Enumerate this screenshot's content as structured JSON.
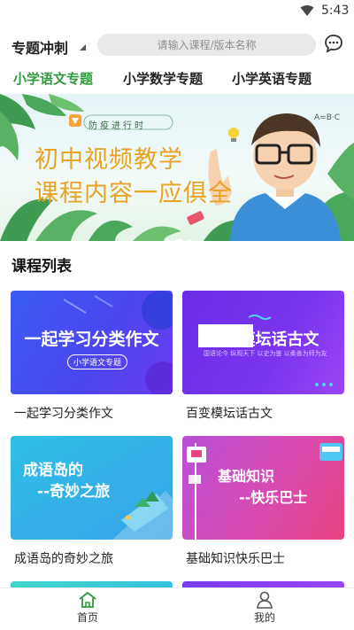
{
  "status_bar": {
    "time": "5:43",
    "wifi_icon": "wifi-icon"
  },
  "header": {
    "title": "专题冲刺",
    "search_placeholder": "请输入课程/版本名称",
    "message_icon": "chat-bubble-icon"
  },
  "tabs": [
    {
      "label": "小学语文专题",
      "active": true
    },
    {
      "label": "小学数学专题",
      "active": false
    },
    {
      "label": "小学英语专题",
      "active": false
    }
  ],
  "banner": {
    "tag": "防疫进行时",
    "headline_1": "初中视频教学",
    "headline_2": "课程内容一应俱全",
    "formula_text": "A=B·C",
    "page_count": 3,
    "active_page": 1
  },
  "section": {
    "title": "课程列表"
  },
  "courses": [
    {
      "title": "一起学习分类作文",
      "thumb_text": "一起学习分类作文",
      "thumb_sub": "小学语文专题",
      "color_a": "#3b57f0",
      "color_b": "#5f3df0"
    },
    {
      "title": "百变模坛话古文",
      "thumb_text": "百变模坛话古文",
      "thumb_sub": "国语论今 纵观天下 以史为鉴 以柔善为师为友",
      "color_a": "#6a2ee8",
      "color_b": "#8a3df2"
    },
    {
      "title": "成语岛的奇妙之旅",
      "thumb_text_1": "成语岛的",
      "thumb_text_2": "--奇妙之旅",
      "color_a": "#2fb8e6",
      "color_b": "#3aa4e8"
    },
    {
      "title": "基础知识快乐巴士",
      "thumb_text_1": "基础知识",
      "thumb_text_2": "--快乐巴士",
      "color_a": "#c84bd6",
      "color_b": "#e2448c"
    }
  ],
  "bottom_nav": [
    {
      "label": "首页",
      "icon": "home-icon",
      "active": true
    },
    {
      "label": "我的",
      "icon": "user-icon",
      "active": false
    }
  ]
}
